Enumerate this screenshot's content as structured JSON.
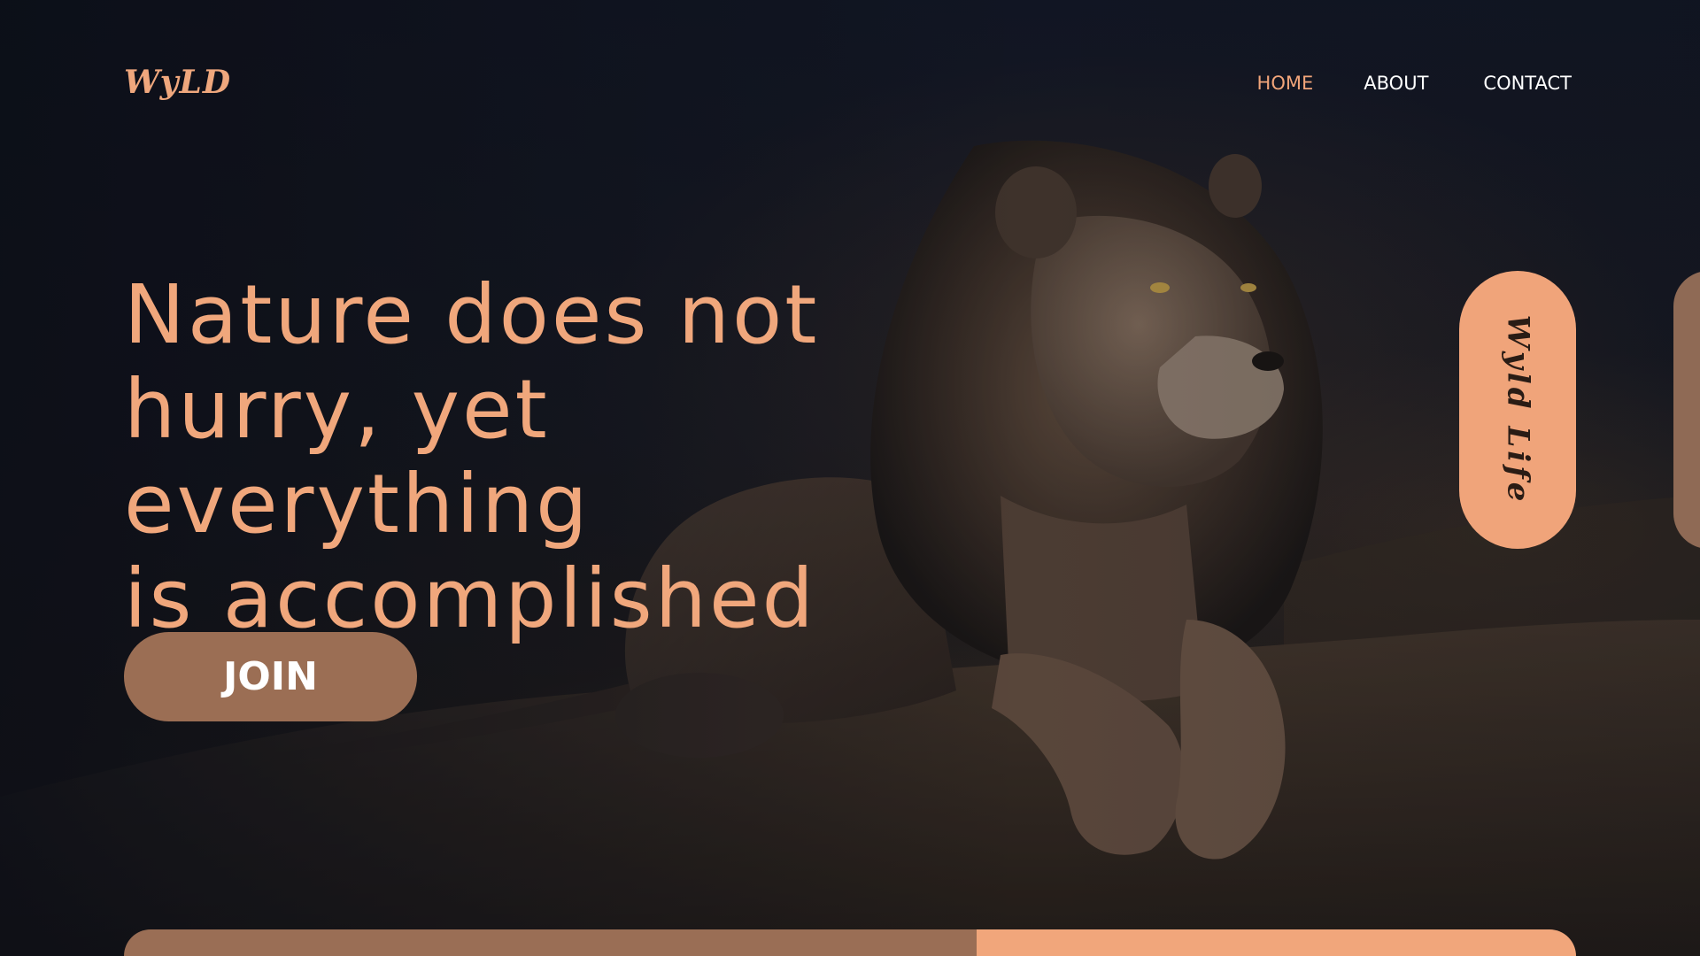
{
  "brand": {
    "logo_text": "WyLD",
    "accent_color": "#f0a77c",
    "button_color": "#9b6e54"
  },
  "nav": {
    "items": [
      {
        "label": "HOME",
        "active": true
      },
      {
        "label": "ABOUT",
        "active": false
      },
      {
        "label": "CONTACT",
        "active": false
      }
    ]
  },
  "hero": {
    "headline_lines": [
      "Nature does not",
      "hurry, yet everything",
      "is accomplished"
    ],
    "join_label": "JOIN",
    "background_image": "lion-resting-on-rock"
  },
  "side_tab": {
    "label": "Wyld Life",
    "color": "#f0a47a"
  }
}
